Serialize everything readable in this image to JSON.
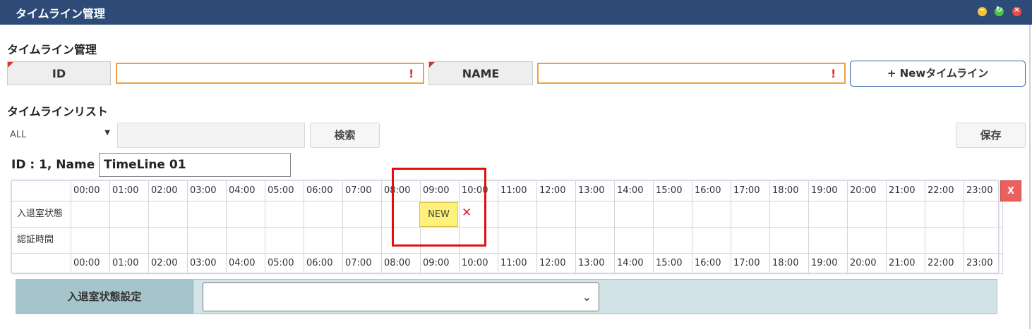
{
  "window": {
    "title": "タイムライン管理"
  },
  "section_main": {
    "title": "タイムライン管理"
  },
  "form": {
    "id_label": "ID",
    "id_value": "",
    "name_label": "NAME",
    "name_value": "",
    "warn_icon": "!",
    "new_button": "+ Newタイムライン"
  },
  "section_list": {
    "title": "タイムラインリスト"
  },
  "filter": {
    "selected": "ALL",
    "search_value": "",
    "search_button": "検索",
    "save_button": "保存"
  },
  "timeline": {
    "header": "ID : 1, Name :",
    "name_value": "TimeLine 01",
    "close_label": "X",
    "hours": [
      "00:00",
      "01:00",
      "02:00",
      "03:00",
      "04:00",
      "05:00",
      "06:00",
      "07:00",
      "08:00",
      "09:00",
      "10:00",
      "11:00",
      "12:00",
      "13:00",
      "14:00",
      "15:00",
      "16:00",
      "17:00",
      "18:00",
      "19:00",
      "20:00",
      "21:00",
      "22:00",
      "23:00"
    ],
    "rows": [
      {
        "label": "入退室状態"
      },
      {
        "label": "認証時間"
      }
    ],
    "new_block_label": "NEW",
    "delete_mark": "✕"
  },
  "setting": {
    "label": "入退室状態設定",
    "selected": ""
  },
  "colors": {
    "titlebar": "#2e4b78",
    "warning": "#d9302c",
    "highlight_frame": "#e01010",
    "new_block": "#fff27a"
  }
}
